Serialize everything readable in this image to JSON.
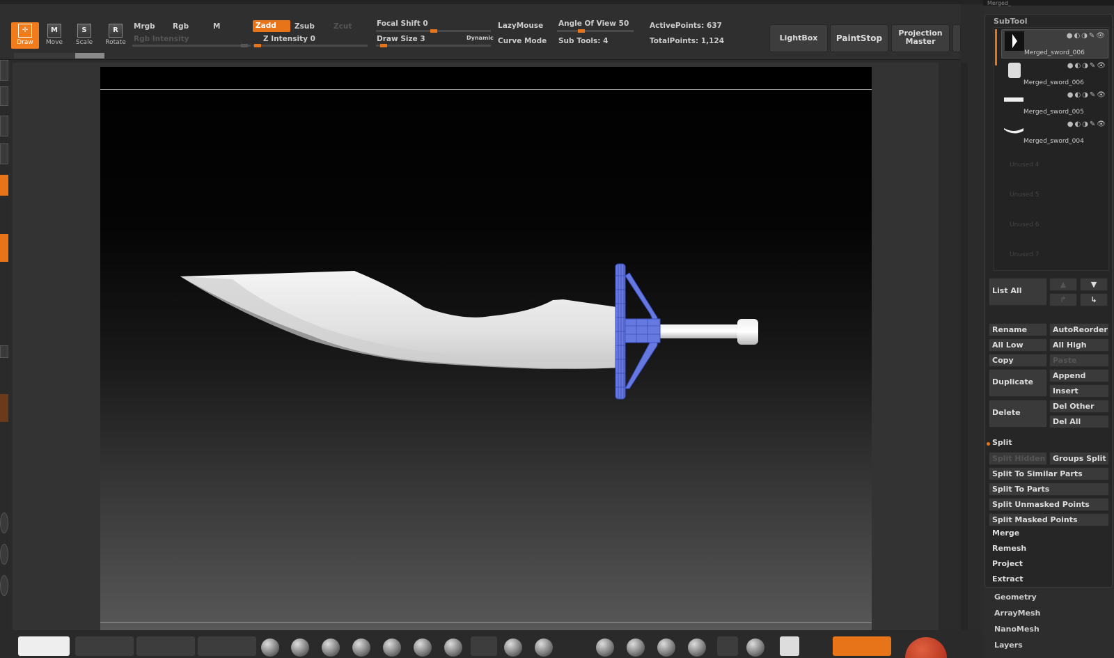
{
  "toolbar": {
    "draw": "Draw",
    "move": "Move",
    "scale": "Scale",
    "rotate": "Rotate",
    "mrgb": "Mrgb",
    "rgb": "Rgb",
    "m": "M",
    "rgb_intensity": "Rgb Intensity",
    "zadd": "Zadd",
    "zsub": "Zsub",
    "zcut": "Zcut",
    "z_intensity": "Z Intensity 0",
    "focal_shift": "Focal Shift 0",
    "draw_size": "Draw Size 3",
    "dynamic": "Dynamic",
    "lazymouse": "LazyMouse",
    "curve_mode": "Curve Mode",
    "angle_of_view": "Angle Of View 50",
    "sub_tools": "Sub Tools: 4",
    "active_points": "ActivePoints: 637",
    "total_points": "TotalPoints: 1,124",
    "lightbox": "LightBox",
    "paintstop": "PaintStop",
    "projection_line1": "Projection",
    "projection_line2": "Master"
  },
  "panel": {
    "title": "SubTool",
    "top_label": "Merged_",
    "subtools": [
      {
        "name": "Merged_sword_006",
        "selected": true
      },
      {
        "name": "Merged_sword_006",
        "selected": false
      },
      {
        "name": "Merged_sword_005",
        "selected": false
      },
      {
        "name": "Merged_sword_004",
        "selected": false
      }
    ],
    "unused": [
      "Unused 4",
      "Unused 5",
      "Unused 6",
      "Unused 7"
    ],
    "list_all": "List All",
    "rename": "Rename",
    "autoreorder": "AutoReorder",
    "all_low": "All Low",
    "all_high": "All High",
    "copy": "Copy",
    "paste": "Paste",
    "duplicate": "Duplicate",
    "append": "Append",
    "insert": "Insert",
    "delete": "Delete",
    "del_other": "Del Other",
    "del_all": "Del All",
    "split": "Split",
    "split_hidden": "Split Hidden",
    "groups_split": "Groups Split",
    "split_similar": "Split To Similar Parts",
    "split_parts": "Split To Parts",
    "split_unmasked": "Split Unmasked Points",
    "split_masked": "Split Masked Points",
    "merge": "Merge",
    "remesh": "Remesh",
    "project": "Project",
    "extract": "Extract",
    "geometry": "Geometry",
    "arraymesh": "ArrayMesh",
    "nanomesh": "NanoMesh",
    "layers": "Layers"
  },
  "colors": {
    "accent": "#e8741a",
    "mesh_highlight": "#5b6fd6"
  }
}
